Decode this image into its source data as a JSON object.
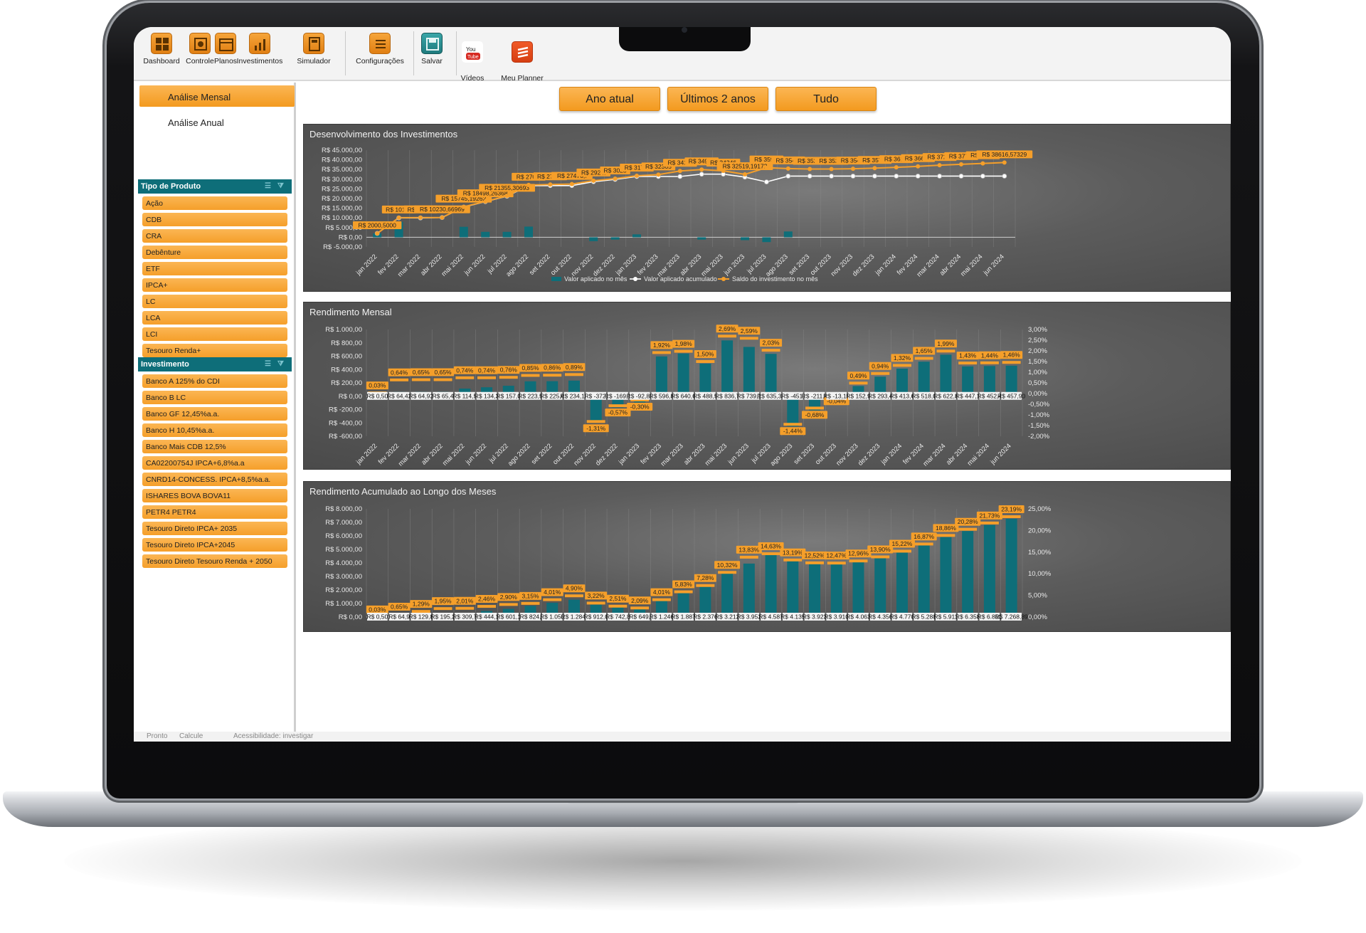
{
  "ribbon": {
    "buttons": [
      {
        "label": "Dashboard",
        "icon": "dashboard-icon"
      },
      {
        "label": "Controle",
        "icon": "control-icon"
      },
      {
        "label": "Planos",
        "icon": "calendar-icon"
      },
      {
        "label": "Investimentos",
        "icon": "chart-icon"
      },
      {
        "label": "Simulador",
        "icon": "calculator-icon"
      },
      {
        "label": "Configurações",
        "icon": "settings-icon"
      },
      {
        "label": "Salvar",
        "icon": "save-icon"
      },
      {
        "label": "Vídeos\nExplicativos",
        "icon": "youtube-icon"
      },
      {
        "label": "Meu Planner\nFinanceiro",
        "icon": "planner-logo-icon"
      }
    ]
  },
  "sidebar": {
    "tabs": [
      "Análise Mensal",
      "Análise Anual"
    ],
    "slicer_tipo": {
      "title": "Tipo de Produto",
      "items": [
        "Ação",
        "CDB",
        "CRA",
        "Debênture",
        "ETF",
        "IPCA+",
        "LC",
        "LCA",
        "LCI",
        "Tesouro Renda+"
      ]
    },
    "slicer_invest": {
      "title": "Investimento",
      "items": [
        "Banco A 125% do CDI",
        "Banco B LC",
        "Banco GF 12,45%a.a.",
        "Banco H 10,45%a.a.",
        "Banco Mais CDB 12,5%",
        "CA02200754J IPCA+6,8%a.a",
        "CNRD14-CONCESS. IPCA+8,5%a.a.",
        "ISHARES BOVA BOVA11",
        "PETR4 PETR4",
        "Tesouro Direto IPCA+ 2035",
        "Tesouro Direto IPCA+2045",
        "Tesouro Direto Tesouro Renda + 2050"
      ]
    }
  },
  "period_buttons": [
    "Ano atual",
    "Últimos 2 anos",
    "Tudo"
  ],
  "status": {
    "left": "Pronto",
    "calc": "Calcule",
    "accessibility": "Acessibilidade: investigar"
  },
  "colors": {
    "orange": "#f59f2a",
    "teal": "#0e6e79",
    "white_line": "#ffffff"
  },
  "chart_data": [
    {
      "type": "line",
      "title": "Desenvolvimento dos Investimentos",
      "categories": [
        "jan 2022",
        "fev 2022",
        "mar 2022",
        "abr 2022",
        "mai 2022",
        "jun 2022",
        "jul 2022",
        "ago 2022",
        "set 2022",
        "out 2022",
        "nov 2022",
        "dez 2022",
        "jan 2023",
        "fev 2023",
        "mar 2023",
        "abr 2023",
        "mai 2023",
        "jun 2023",
        "jul 2023",
        "ago 2023",
        "set 2023",
        "out 2023",
        "nov 2023",
        "dez 2023",
        "jan 2024",
        "fev 2024",
        "mar 2024",
        "abr 2024",
        "mai 2024",
        "jun 2024"
      ],
      "y_tick_labels": [
        "R$ 45.000,00",
        "R$ 40.000,00",
        "R$ 35.000,00",
        "R$ 30.000,00",
        "R$ 25.000,00",
        "R$ 20.000,00",
        "R$ 15.000,00",
        "R$ 10.000,00",
        "R$ 5.000,00",
        "R$ 0,00",
        "R$ -5.000,00"
      ],
      "ylim": [
        -5000,
        45000
      ],
      "series": [
        {
          "name": "Valor aplicado no mês",
          "kind": "bar",
          "values": [
            2000,
            8000,
            0,
            0,
            5400,
            2800,
            2800,
            5500,
            0,
            0,
            -2000,
            -1200,
            1500,
            0,
            0,
            -1200,
            0,
            -1500,
            -2500,
            3000,
            0,
            0,
            0,
            0,
            0,
            0,
            0,
            0,
            0,
            0
          ]
        },
        {
          "name": "Valor aplicado acumulado",
          "kind": "line",
          "values": [
            2000,
            10000,
            10000,
            10200,
            15600,
            18400,
            21200,
            26700,
            26700,
            26700,
            28700,
            29900,
            31400,
            31400,
            31400,
            32600,
            32600,
            31100,
            28600,
            31600,
            31600,
            31600,
            31600,
            31600,
            31600,
            31600,
            31600,
            31600,
            31600,
            31600
          ]
        },
        {
          "name": "Saldo do investimento no mês",
          "kind": "line",
          "values": [
            2000.5,
            10100,
            10160,
            10230.67,
            15745.19,
            18498.26,
            21355.31,
            27010,
            27240,
            27476,
            29245,
            30283,
            31770,
            32365,
            34250,
            34990,
            34340,
            32519.19,
            35930,
            35480,
            35270,
            35250,
            35410,
            35700,
            36110,
            36630,
            37250,
            37700,
            38150,
            38616.57
          ]
        }
      ],
      "data_labels": [
        "R$ 2000,5000",
        "R$ 1010€",
        "R$ 1016€",
        "R$ 10230,66969",
        "R$ 15745,19262",
        "R$ 18498,26368",
        "R$ 21355,30693",
        "R$ 2701!",
        "R$ 2724€",
        "R$ 27476,!",
        "R$ 2924!",
        "R$ 3028",
        "R$ 3177:",
        "R$ 32365",
        "R$ 3425!",
        "R$ 3499€",
        "R$ 34346",
        "R$ 32519,19172",
        "R$ 3593!",
        "R$ 3548:",
        "R$ 3527:",
        "R$ 3525!",
        "R$ 3541:",
        "R$ 3570:",
        "R$ 3611:",
        "R$ 3663€",
        "R$ 3725!",
        "R$ 3770!",
        "R$ 3815!",
        "R$ 38616,57329"
      ]
    },
    {
      "type": "bar",
      "title": "Rendimento Mensal",
      "categories": [
        "jan 2022",
        "fev 2022",
        "mar 2022",
        "abr 2022",
        "mai 2022",
        "jun 2022",
        "jul 2022",
        "ago 2022",
        "set 2022",
        "out 2022",
        "nov 2022",
        "dez 2022",
        "jan 2023",
        "fev 2023",
        "mar 2023",
        "abr 2023",
        "mai 2023",
        "jun 2023",
        "jul 2023",
        "ago 2023",
        "set 2023",
        "out 2023",
        "nov 2023",
        "dez 2023",
        "jan 2024",
        "fev 2024",
        "mar 2024",
        "abr 2024",
        "mai 2024",
        "jun 2024"
      ],
      "y_tick_labels": [
        "R$ 1.000,00",
        "R$ 800,00",
        "R$ 600,00",
        "R$ 400,00",
        "R$ 200,00",
        "R$ 0,00",
        "R$ -200,00",
        "R$ -400,00",
        "R$ -600,00"
      ],
      "y2_tick_labels": [
        "3,00%",
        "2,50%",
        "2,00%",
        "1,50%",
        "1,00%",
        "0,50%",
        "0,00%",
        "-0,50%",
        "-1,00%",
        "-1,50%",
        "-2,00%"
      ],
      "ylim": [
        -600,
        1000
      ],
      "y2lim": [
        -2,
        3
      ],
      "values": [
        0.5,
        64.42,
        64.92,
        65.4,
        114.5,
        134.3,
        157.0,
        223.5,
        225.6,
        234.1,
        -372,
        -169.1,
        -92.89,
        596.8,
        640.6,
        488.5,
        836.7,
        739.1,
        635.34,
        -451,
        -211.8,
        -13.15,
        152.9,
        293.4,
        413.6,
        518.0,
        622.8,
        447.1,
        452.4,
        457.9
      ],
      "value_labels": [
        "R$ 0,50",
        "R$ 64,42",
        "R$ 64,92",
        "R$ 65,4",
        "R$ 114,5",
        "R$ 134,3",
        "R$ 157,0",
        "R$ 223,5",
        "R$ 225,6",
        "R$ 234,10",
        "R$ -372,",
        "R$ -169,1",
        "R$ -92,89",
        "R$ 596,8",
        "R$ 640,6",
        "R$ 488,5",
        "R$ 836,7",
        "R$ 739,1",
        "R$ 635,34",
        "R$ -451,",
        "R$ -211,8",
        "R$ -13,15",
        "R$ 152,9",
        "R$ 293,4",
        "R$ 413,6",
        "R$ 518,0",
        "R$ 622,8",
        "R$ 447,1",
        "R$ 452,4",
        "R$ 457,90"
      ],
      "pct": [
        0.03,
        0.64,
        0.65,
        0.65,
        0.74,
        0.74,
        0.76,
        0.85,
        0.86,
        0.89,
        -1.31,
        -0.57,
        -0.3,
        1.92,
        1.98,
        1.5,
        2.69,
        2.59,
        2.03,
        -1.44,
        -0.68,
        -0.04,
        0.49,
        0.94,
        1.32,
        1.65,
        1.99,
        1.43,
        1.44,
        1.46
      ],
      "pct_labels": [
        "0,03%",
        "0,64%",
        "0,65%",
        "0,65%",
        "0,74%",
        "0,74%",
        "0,76%",
        "0,85%",
        "0,86%",
        "0,89%",
        "-1,31%",
        "-0,57%",
        "-0,30%",
        "1,92%",
        "1,98%",
        "1,50%",
        "2,69%",
        "2,59%",
        "2,03%",
        "-1,44%",
        "-0,68%",
        "-0,04%",
        "0,49%",
        "0,94%",
        "1,32%",
        "1,65%",
        "1,99%",
        "1,43%",
        "1,44%",
        "1,46%"
      ]
    },
    {
      "type": "bar",
      "title": "Rendimento Acumulado ao Longo dos Meses",
      "categories": [
        "jan 2022",
        "fev 2022",
        "mar 2022",
        "abr 2022",
        "mai 2022",
        "jun 2022",
        "jul 2022",
        "ago 2022",
        "set 2022",
        "out 2022",
        "nov 2022",
        "dez 2022",
        "jan 2023",
        "fev 2023",
        "mar 2023",
        "abr 2023",
        "mai 2023",
        "jun 2023",
        "jul 2023",
        "ago 2023",
        "set 2023",
        "out 2023",
        "nov 2023",
        "dez 2023",
        "jan 2024",
        "fev 2024",
        "mar 2024",
        "abr 2024",
        "mai 2024",
        "jun 2024"
      ],
      "y_tick_labels": [
        "R$ 8.000,00",
        "R$ 7.000,00",
        "R$ 6.000,00",
        "R$ 5.000,00",
        "R$ 4.000,00",
        "R$ 3.000,00",
        "R$ 2.000,00",
        "R$ 1.000,00",
        "R$ 0,00"
      ],
      "y2_tick_labels": [
        "25,00%",
        "20,00%",
        "15,00%",
        "10,00%",
        "5,00%",
        "0,00%"
      ],
      "ylim": [
        0,
        8000
      ],
      "y2lim": [
        0,
        25
      ],
      "values": [
        0.5,
        64.9,
        129.8,
        195.2,
        309.7,
        444.1,
        601.1,
        824,
        1050,
        1284,
        912,
        742.8,
        649,
        1246,
        1887,
        2376,
        3212,
        3952,
        4587,
        4135,
        3923,
        3910,
        4063,
        4356,
        4770,
        5288,
        5911,
        6358,
        6810,
        7268.89
      ],
      "value_labels": [
        "R$ 0,50",
        "R$ 64,9",
        "R$ 129,8",
        "R$ 195,2",
        "R$ 309,7",
        "R$ 444,1",
        "R$ 601,1",
        "R$ 824,",
        "R$ 1.050",
        "R$ 1.284,",
        "R$ 912,0",
        "R$ 742,8",
        "R$ 649,",
        "R$ 1.246",
        "R$ 1.887",
        "R$ 2.376",
        "R$ 3.212",
        "R$ 3.952",
        "R$ 4.587",
        "R$ 4.135",
        "R$ 3.923",
        "R$ 3.910",
        "R$ 4.063",
        "R$ 4.356",
        "R$ 4.770",
        "R$ 5.288",
        "R$ 5.911",
        "R$ 6.358",
        "R$ 6.810",
        "R$ 7.268,89"
      ],
      "pct": [
        0.03,
        0.65,
        1.29,
        1.95,
        2.01,
        2.46,
        2.9,
        3.15,
        4.01,
        4.9,
        3.22,
        2.51,
        2.09,
        4.01,
        5.83,
        7.28,
        10.32,
        13.83,
        14.63,
        13.19,
        12.52,
        12.47,
        12.96,
        13.9,
        15.22,
        16.87,
        18.86,
        20.28,
        21.73,
        23.19
      ],
      "pct_labels": [
        "0,03%",
        "0,65%",
        "1,29%",
        "1,95%",
        "2,01%",
        "2,46%",
        "2,90%",
        "3,15%",
        "4,01%",
        "4,90%",
        "3,22%",
        "2,51%",
        "2,09%",
        "4,01%",
        "5,83%",
        "7,28%",
        "10,32%",
        "13,83%",
        "14,63%",
        "13,19%",
        "12,52%",
        "12,47%",
        "12,96%",
        "13,90%",
        "15,22%",
        "16,87%",
        "18,86%",
        "20,28%",
        "21,73%",
        "23,19%"
      ]
    }
  ]
}
